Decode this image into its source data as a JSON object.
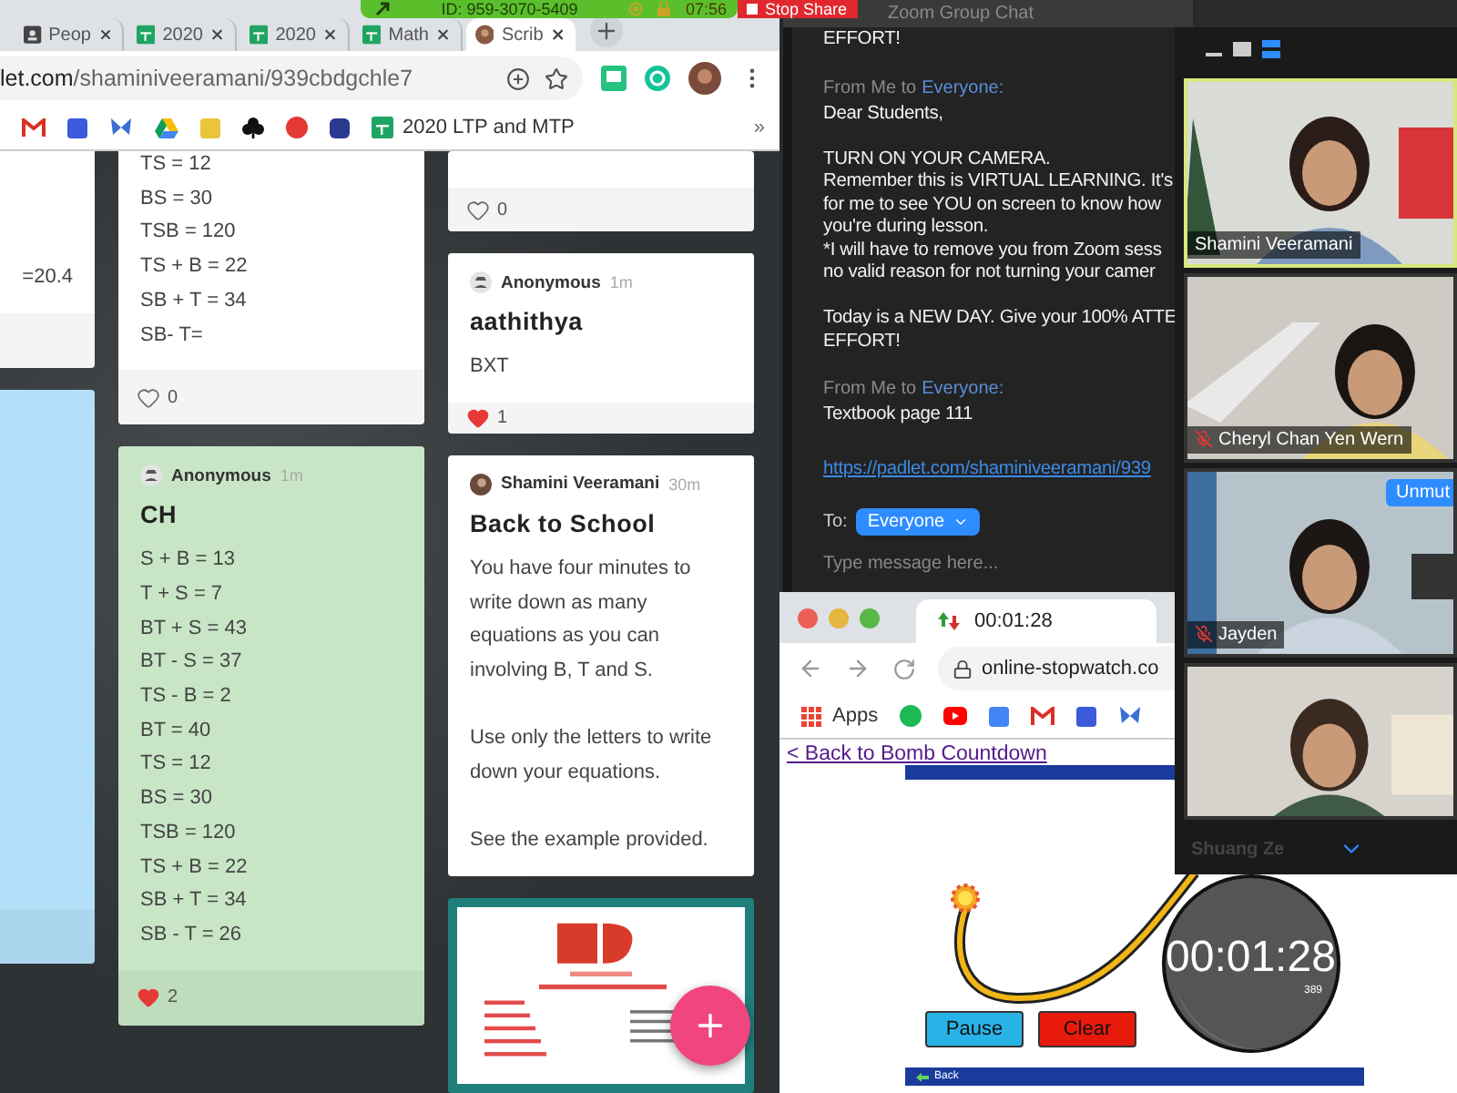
{
  "zoom_share_bar": {
    "meeting_id": "ID: 959-3070-5409",
    "time": "07:56",
    "stop_button": "Stop Share"
  },
  "padlet_browser": {
    "tabs": [
      {
        "kind": "contacts",
        "label": "Peop",
        "selected": false
      },
      {
        "kind": "sheet",
        "label": "2020",
        "selected": false
      },
      {
        "kind": "sheet",
        "label": "2020",
        "selected": false
      },
      {
        "kind": "sheet",
        "label": "Math",
        "selected": false
      },
      {
        "kind": "avatar",
        "label": "Scrib",
        "selected": true
      }
    ],
    "address": {
      "domain": "let.com",
      "path": "/shaminiveeramani/939cbdgchle7"
    },
    "bookmark": "2020 LTP and MTP",
    "more": "»"
  },
  "board": {
    "columns": [
      {
        "cards": [
          {
            "kind": "post",
            "color": "#ffffff",
            "lines": [
              "=20.4"
            ]
          },
          {
            "kind": "post",
            "color": "#b3e0f8"
          }
        ]
      },
      {
        "cards": [
          {
            "kind": "post",
            "color": "#ffffff",
            "lines": [
              "TS = 12",
              "BS = 30",
              "TSB = 120",
              "TS + B = 22",
              "SB + T = 34",
              "SB- T="
            ],
            "likes": "0",
            "liked": false
          },
          {
            "kind": "post",
            "color": "#c8e6c6",
            "author": "Anonymous",
            "time": "1m",
            "title": "CH",
            "lines": [
              "S + B = 13",
              "T + S = 7",
              "BT + S = 43",
              "BT - S = 37",
              "TS - B = 2",
              "BT = 40",
              "TS = 12",
              "BS = 30",
              "TSB = 120",
              "TS + B = 22",
              "SB + T = 34",
              "SB - T = 26"
            ],
            "likes": "2",
            "liked": true
          }
        ]
      },
      {
        "cards": [
          {
            "kind": "post",
            "color": "#ffffff",
            "likes": "0",
            "liked": false
          },
          {
            "kind": "post",
            "color": "#ffffff",
            "author": "Anonymous",
            "time": "1m",
            "title": "aathithya",
            "lines": [
              "BXT"
            ],
            "likes": "1",
            "liked": true
          },
          {
            "kind": "post",
            "color": "#ffffff",
            "author": "Shamini Veeramani",
            "time": "30m",
            "title": "Back to School",
            "paragraphs": [
              "You have four minutes to write down as many equations as you can involving B, T and S.",
              "Use only the letters to write down your equations.",
              "See the example provided."
            ]
          },
          {
            "kind": "picture"
          }
        ]
      }
    ]
  },
  "chat": {
    "title": "Zoom Group Chat",
    "messages": [
      {
        "paragraphs": [
          [
            "EFFORT!"
          ]
        ]
      },
      {
        "from": "From Me to",
        "to": "Everyone:",
        "paragraphs": [
          [
            "Dear Students,"
          ],
          [
            "TURN ON YOUR CAMERA.",
            "Remember this is VIRTUAL LEARNING. It's",
            "for me to see YOU on screen to know how",
            "you're during lesson.",
            "*I will have to remove you from Zoom sess",
            "no valid reason for not turning your camer"
          ],
          [
            "Today is a NEW DAY. Give your 100% ATTE",
            "EFFORT!"
          ]
        ]
      },
      {
        "from": "From Me to",
        "to": "Everyone:",
        "paragraphs": [
          [
            "Textbook page 111"
          ]
        ],
        "link": "https://padlet.com/shaminiveeramani/939"
      }
    ],
    "to_label": "To:",
    "recipient": "Everyone",
    "placeholder": "Type message here..."
  },
  "video_panel": {
    "tiles": [
      {
        "kind": "overlay",
        "name": "Shamini Veeramani",
        "muted": false,
        "active": true
      },
      {
        "kind": "overlay",
        "name": "Cheryl Chan Yen Wern",
        "muted": true,
        "active": false
      },
      {
        "kind": "overlay",
        "name": "Jayden",
        "muted": true,
        "active": false,
        "button": "Unmut"
      },
      {
        "kind": "footer",
        "name": "Shuang Ze",
        "muted": false,
        "active": false
      }
    ]
  },
  "stopwatch_browser": {
    "tab": "00:01:28",
    "address": "online-stopwatch.co",
    "apps": "Apps",
    "back_link": "< Back to Bomb Countdown",
    "timer": "00:01:28",
    "timer_sub": "389",
    "buttons": [
      "Pause",
      "Clear"
    ],
    "footer_link": "Back"
  }
}
